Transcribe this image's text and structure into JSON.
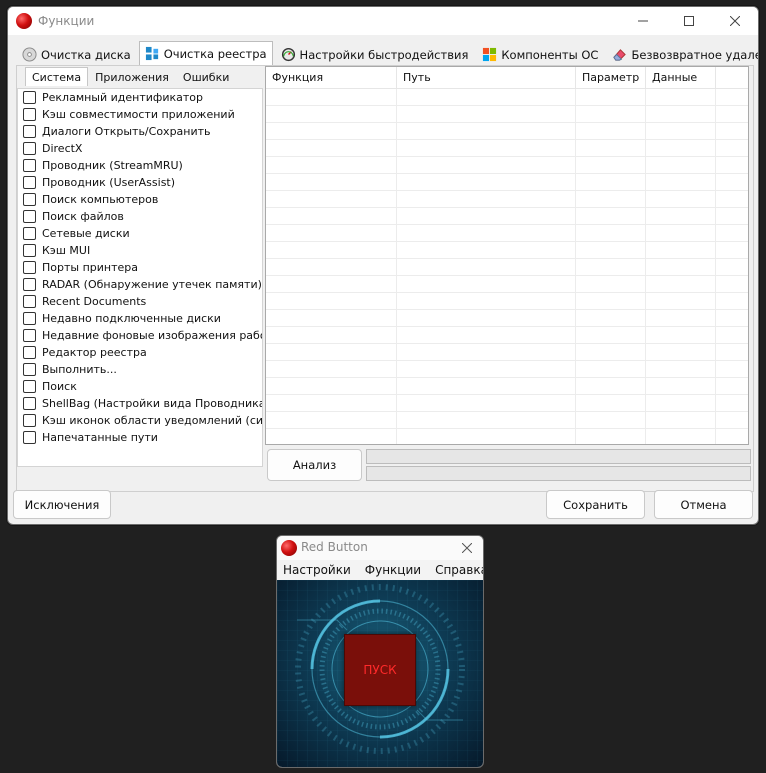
{
  "main_window": {
    "title": "Функции",
    "tabs": [
      {
        "label": "Очистка диска",
        "icon": "disk-cleanup-icon"
      },
      {
        "label": "Очистка реестра",
        "icon": "registry-icon"
      },
      {
        "label": "Настройки быстродействия",
        "icon": "speedometer-icon"
      },
      {
        "label": "Компоненты ОС",
        "icon": "windows-logo-icon"
      },
      {
        "label": "Безвозвратное удаление",
        "icon": "eraser-icon"
      }
    ],
    "active_tab": "Очистка реестра",
    "subtabs": [
      {
        "label": "Система"
      },
      {
        "label": "Приложения"
      },
      {
        "label": "Ошибки"
      }
    ],
    "active_subtab": "Система",
    "items": [
      {
        "label": "Рекламный идентификатор",
        "checked": false
      },
      {
        "label": "Кэш совместимости приложений",
        "checked": false
      },
      {
        "label": "Диалоги Открыть/Сохранить",
        "checked": false
      },
      {
        "label": "DirectX",
        "checked": false
      },
      {
        "label": "Проводник (StreamMRU)",
        "checked": false
      },
      {
        "label": "Проводник (UserAssist)",
        "checked": false
      },
      {
        "label": "Поиск компьютеров",
        "checked": false
      },
      {
        "label": "Поиск файлов",
        "checked": false
      },
      {
        "label": "Сетевые диски",
        "checked": false
      },
      {
        "label": "Кэш MUI",
        "checked": false
      },
      {
        "label": "Порты принтера",
        "checked": false
      },
      {
        "label": "RADAR (Обнаружение утечек памяти)",
        "checked": false
      },
      {
        "label": "Recent Documents",
        "checked": false
      },
      {
        "label": "Недавно подключенные диски",
        "checked": false
      },
      {
        "label": "Недавние фоновые изображения рабочего",
        "checked": false
      },
      {
        "label": "Редактор реестра",
        "checked": false
      },
      {
        "label": "Выполнить...",
        "checked": false
      },
      {
        "label": "Поиск",
        "checked": false
      },
      {
        "label": "ShellBag (Настройки вида Проводника)",
        "checked": false
      },
      {
        "label": "Кэш иконок области уведомлений (системн",
        "checked": false
      },
      {
        "label": "Напечатанные пути",
        "checked": false
      }
    ],
    "grid_columns": [
      "Функция",
      "Путь",
      "Параметр",
      "Данные"
    ],
    "grid_rows": [],
    "analyze_label": "Анализ",
    "progress": [
      0,
      0
    ],
    "exceptions_label": "Исключения",
    "save_label": "Сохранить",
    "cancel_label": "Отмена"
  },
  "mini_window": {
    "title": "Red Button",
    "menu": [
      "Настройки",
      "Функции",
      "Справка"
    ],
    "start_label": "ПУСК"
  },
  "colors": {
    "desktop": "#202020",
    "window_bg": "#f0f0f0",
    "start_button": "#7a0f0a",
    "start_text": "#ff2a2a",
    "art_cyan": "#1e6a85"
  }
}
